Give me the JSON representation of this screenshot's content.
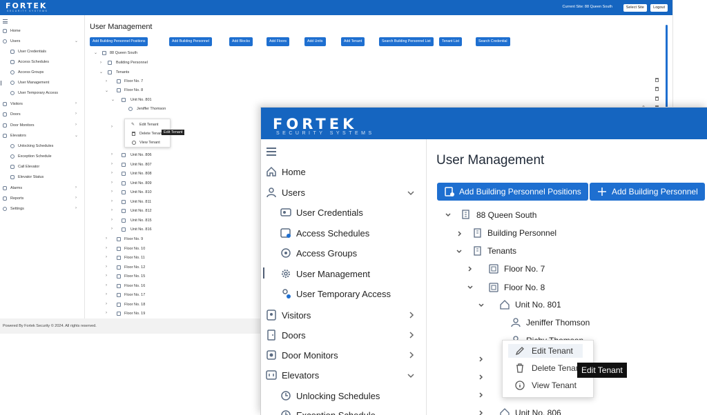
{
  "brand": {
    "name": "FORTEK",
    "tagline": "SECURITY SYSTEMS"
  },
  "header": {
    "current_site": "Current Site: 88 Queen South",
    "select_site": "Select Site",
    "logout": "Logout"
  },
  "sidebar": {
    "items": [
      {
        "label": "Home",
        "icon": "home-icon"
      },
      {
        "label": "Users",
        "icon": "user-icon"
      },
      {
        "label": "User Credentials",
        "icon": "id-card-icon"
      },
      {
        "label": "Access Schedules",
        "icon": "calendar-icon"
      },
      {
        "label": "Access Groups",
        "icon": "group-icon"
      },
      {
        "label": "User Management",
        "icon": "gear-icon"
      },
      {
        "label": "User Temporary Access",
        "icon": "user-clock-icon"
      },
      {
        "label": "Visitors",
        "icon": "visitor-icon"
      },
      {
        "label": "Doors",
        "icon": "door-icon"
      },
      {
        "label": "Door Monitors",
        "icon": "monitor-icon"
      },
      {
        "label": "Elevators",
        "icon": "elevator-icon"
      },
      {
        "label": "Unlocking Schedules",
        "icon": "clock-icon"
      },
      {
        "label": "Exception Schedule",
        "icon": "clock-icon"
      },
      {
        "label": "Call Elevator",
        "icon": "elevator-icon"
      },
      {
        "label": "Elevator Status",
        "icon": "elevator-icon"
      },
      {
        "label": "Alarms",
        "icon": "alarm-icon"
      },
      {
        "label": "Reports",
        "icon": "report-icon"
      },
      {
        "label": "Settings",
        "icon": "settings-icon"
      }
    ]
  },
  "main": {
    "title": "User Management",
    "toolbar": [
      "Add Building Personnel Positions",
      "Add Building Personnel",
      "Add Blocks",
      "Add Floors",
      "Add Units",
      "Add Tenant",
      "Search Building Personnel List",
      "Tenant List",
      "Search Credential"
    ],
    "tree": {
      "site": "88 Queen South",
      "building_personnel": "Building Personnel",
      "tenants": "Tenants",
      "floor7": "Floor No. 7",
      "floor8": "Floor No. 8",
      "unit801": "Unit No. 801",
      "tenant1": "Jeniffer Thomson",
      "tenant2": "Richy Thomson",
      "units": [
        "Unit No. 806",
        "Unit No. 807",
        "Unit No. 808",
        "Unit No. 809",
        "Unit No. 810",
        "Unit No. 811",
        "Unit No. 812",
        "Unit No. 815",
        "Unit No. 816"
      ],
      "floors": [
        "Floor No. 9",
        "Floor No. 10",
        "Floor No. 11",
        "Floor No. 12",
        "Floor No. 15",
        "Floor No. 16",
        "Floor No. 17",
        "Floor No. 18",
        "Floor No. 19"
      ]
    },
    "context_menu": {
      "edit": "Edit Tenant",
      "delete": "Delete Tenant",
      "view": "View Tenant",
      "tooltip": "Edit Tenant"
    }
  },
  "footer": {
    "text": "Powered By Fortek Security © 2024. All rights reserved."
  }
}
